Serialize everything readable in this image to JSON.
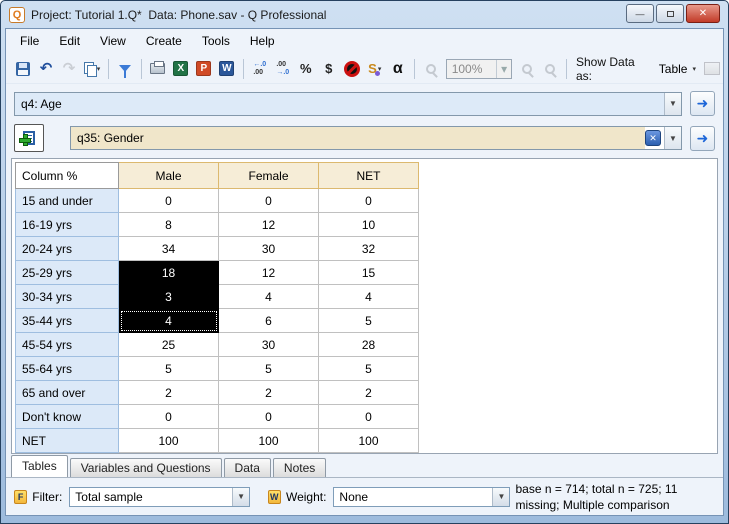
{
  "window": {
    "title": "Project: Tutorial 1.Q*  Data: Phone.sav - Q Professional"
  },
  "icons": {
    "caret": "▾",
    "dropdown_caret": "▼",
    "undo": "↶",
    "redo": "↷",
    "excel_letter": "X",
    "powerpoint_letter": "P",
    "word_letter": "W",
    "inc_top": "←.0",
    "inc_bottom": ".00",
    "dec_top": ".00",
    "dec_bottom": "→.0",
    "percent": "%",
    "dollar": "$",
    "alpha": "α",
    "swoosh": "S",
    "arrow_right": "➜",
    "close_x": "✕",
    "minimize": "—",
    "app_logo": "Q"
  },
  "menu": {
    "items": [
      "File",
      "Edit",
      "View",
      "Create",
      "Tools",
      "Help"
    ]
  },
  "toolbar": {
    "zoom_value": "100%",
    "show_data_as_label": "Show Data as:",
    "show_data_as_value": "Table"
  },
  "questions": {
    "primary": "q4: Age",
    "secondary": "q35: Gender"
  },
  "table": {
    "corner_label": "Column %",
    "columns": [
      "Male",
      "Female",
      "NET"
    ],
    "rows": [
      {
        "label": "15 and under",
        "values": [
          "0",
          "0",
          "0"
        ]
      },
      {
        "label": "16-19 yrs",
        "values": [
          "8",
          "12",
          "10"
        ]
      },
      {
        "label": "20-24 yrs",
        "values": [
          "34",
          "30",
          "32"
        ]
      },
      {
        "label": "25-29 yrs",
        "values": [
          "18",
          "12",
          "15"
        ]
      },
      {
        "label": "30-34 yrs",
        "values": [
          "3",
          "4",
          "4"
        ]
      },
      {
        "label": "35-44 yrs",
        "values": [
          "4",
          "6",
          "5"
        ]
      },
      {
        "label": "45-54 yrs",
        "values": [
          "25",
          "30",
          "28"
        ]
      },
      {
        "label": "55-64 yrs",
        "values": [
          "5",
          "5",
          "5"
        ]
      },
      {
        "label": "65 and over",
        "values": [
          "2",
          "2",
          "2"
        ]
      },
      {
        "label": "Don't know",
        "values": [
          "0",
          "0",
          "0"
        ]
      },
      {
        "label": "NET",
        "values": [
          "100",
          "100",
          "100"
        ]
      }
    ],
    "selected_cells": [
      [
        3,
        0
      ],
      [
        4,
        0
      ],
      [
        5,
        0
      ]
    ],
    "focused_cell": [
      5,
      0
    ],
    "colors": {
      "header_bg": "#F6EDD7",
      "header_border": "#DCB96F",
      "rowlabel_bg": "#DCE9F8",
      "rowlabel_border": "#9FBEE0",
      "selected_bg": "#000000"
    }
  },
  "tabs": {
    "items": [
      "Tables",
      "Variables and Questions",
      "Data",
      "Notes"
    ],
    "active": "Tables"
  },
  "bottom_bar": {
    "filter_icon": "F",
    "filter_label": "Filter:",
    "filter_value": "Total sample",
    "weight_icon": "W",
    "weight_label": "Weight:",
    "weight_value": "None",
    "status": "base n = 714; total n = 725; 11 missing; Multiple comparison"
  }
}
